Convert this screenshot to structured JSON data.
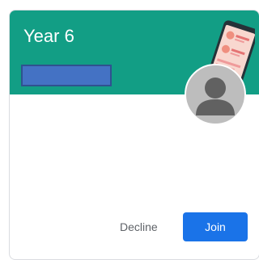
{
  "card": {
    "title": "Year 6",
    "header_color": "#129e85",
    "redaction_color": "#4472c4",
    "avatar_icon": "default-person-avatar",
    "illustration": "phone-illustration"
  },
  "actions": {
    "decline_label": "Decline",
    "join_label": "Join",
    "join_color": "#1a73e8"
  }
}
